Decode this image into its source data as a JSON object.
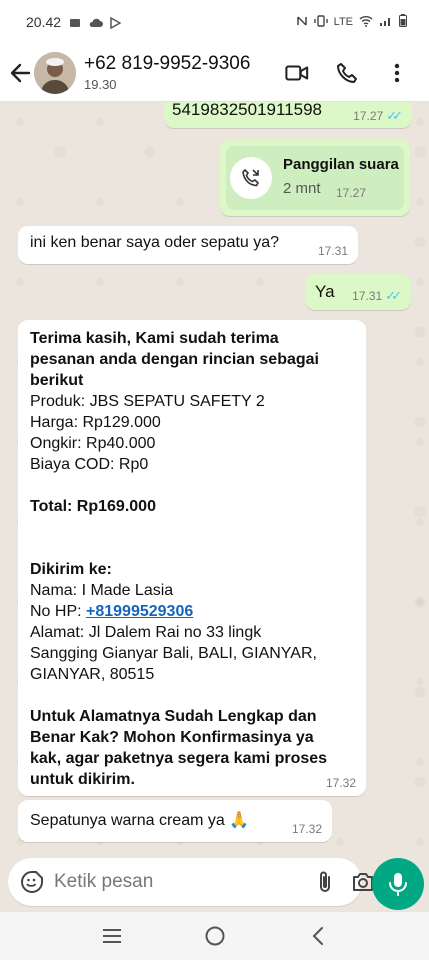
{
  "status_bar": {
    "time": "20.42",
    "right_indicators": "LTE"
  },
  "header": {
    "contact_name": "+62 819-9952-9306",
    "contact_subtitle": "19.30"
  },
  "messages": {
    "m0": {
      "text": "5419832501911598",
      "time": "17.27",
      "status": "read"
    },
    "m1": {
      "title": "Panggilan suara",
      "duration": "2 mnt",
      "time": "17.27"
    },
    "m2": {
      "text": "ini ken benar saya oder sepatu ya?",
      "time": "17.31"
    },
    "m3": {
      "text": "Ya",
      "time": "17.31",
      "status": "read"
    },
    "m4": {
      "l1": "Terima kasih, Kami sudah terima",
      "l2": "pesanan anda dengan rincian sebagai",
      "l3": "berikut",
      "l4": "Produk: JBS SEPATU SAFETY 2",
      "l5": "Harga: Rp129.000",
      "l6": "Ongkir: Rp40.000",
      "l7": "Biaya COD: Rp0",
      "l8": "Total: Rp169.000",
      "l9": "Dikirim ke:",
      "l10": "Nama: I Made Lasia",
      "l11_label": "No HP: ",
      "l11_link": "+81999529306",
      "l12": "Alamat: Jl Dalem Rai no 33 lingk",
      "l13": "Sangging Gianyar Bali, BALI, GIANYAR,",
      "l14": "GIANYAR, 80515",
      "l15": "Untuk Alamatnya Sudah Lengkap dan",
      "l16": "Benar Kak? Mohon Konfirmasinya ya",
      "l17": "kak, agar paketnya segera kami proses",
      "l18": "untuk dikirim.",
      "time": "17.32"
    },
    "m5": {
      "text": "Sepatunya warna cream ya 🙏",
      "time": "17.32"
    }
  },
  "input": {
    "placeholder": "Ketik pesan"
  },
  "icons": {
    "accent": "#00a884",
    "read_tick_color": "#4fc3f7",
    "outgoing_bubble": "#dcf8c6",
    "incoming_bubble": "#ffffff"
  }
}
